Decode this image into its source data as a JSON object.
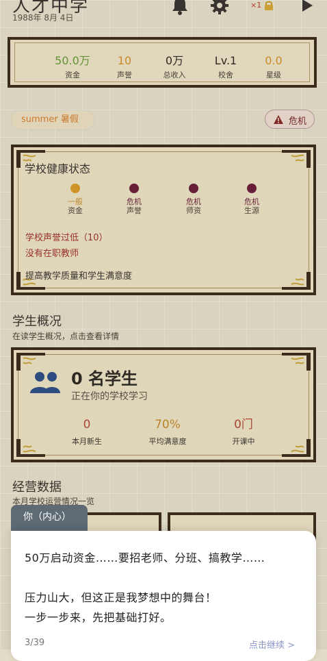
{
  "header": {
    "school_name": "人才中学",
    "date": "1988年 8月 4日",
    "speed_label": "×1",
    "icons": [
      "bell-icon",
      "gear-icon",
      "lock-icon",
      "play-icon"
    ]
  },
  "stats": [
    {
      "value": "50.0万",
      "label": "资金",
      "color": "#6a9a3a"
    },
    {
      "value": "10",
      "label": "声誉",
      "color": "#d6912a"
    },
    {
      "value": "0万",
      "label": "总收入",
      "color": "#2e2b27"
    },
    {
      "value": "Lv.1",
      "label": "校舍",
      "color": "#2e2b27"
    },
    {
      "value": "0.0",
      "label": "星级",
      "color": "#d6912a"
    }
  ],
  "season": "summer 暑假",
  "danger_label": "危机",
  "health": {
    "title": "学校健康状态",
    "indicators": [
      {
        "status": "一般",
        "name": "资金",
        "color": "#d99a2b"
      },
      {
        "status": "危机",
        "name": "声誉",
        "color": "#6b1f3a"
      },
      {
        "status": "危机",
        "name": "师资",
        "color": "#6b1f3a"
      },
      {
        "status": "危机",
        "name": "生源",
        "color": "#6b1f3a"
      }
    ],
    "warnings": [
      "学校声誉过低（10）",
      "没有在职教师"
    ],
    "advice": "提高教学质量和学生满意度"
  },
  "students": {
    "title": "学生概况",
    "subtitle": "在读学生概况，点击查看详情",
    "count": "0 名学生",
    "count_sub": "正在你的学校学习",
    "stats": [
      {
        "value": "0",
        "label": "本月新生",
        "color": "#b44b3a"
      },
      {
        "value": "70%",
        "label": "平均满意度",
        "color": "#c48a2a"
      },
      {
        "value": "0门",
        "label": "开课中",
        "color": "#b44b3a"
      }
    ]
  },
  "operations": {
    "title": "经营数据",
    "subtitle": "本月学校运营情况一览"
  },
  "dialog": {
    "speaker": "你（内心）",
    "lines": [
      "50万启动资金……要招老师、分班、搞教学……",
      "压力山大，但这正是我梦想中的舞台！",
      "一步一步来，先把基础打好。"
    ],
    "progress": "3/39",
    "continue": "点击继续 >"
  }
}
